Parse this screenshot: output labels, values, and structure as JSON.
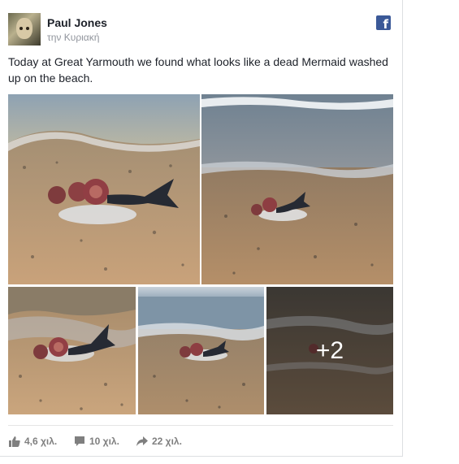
{
  "post": {
    "author": "Paul Jones",
    "time": "την Κυριακή",
    "text": "Today at Great Yarmouth we found what looks like a dead Mermaid washed up on the beach.",
    "platform_icon": "facebook-icon",
    "photos": {
      "count_shown": 5,
      "more_label": "+2"
    },
    "stats": {
      "likes": "4,6 χιλ.",
      "comments": "10 χιλ.",
      "shares": "22 χιλ."
    }
  },
  "colors": {
    "brand": "#3b5998",
    "meta_text": "#90949c",
    "stat_text": "#7f7f7f"
  }
}
